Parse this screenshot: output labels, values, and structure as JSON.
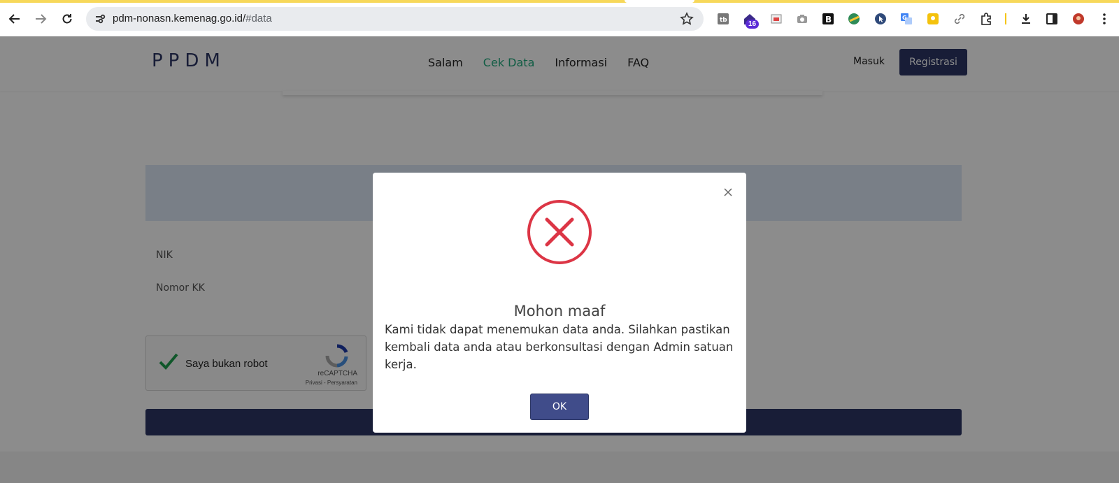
{
  "browser": {
    "url_host": "pdm-nonasn.kemenag.go.id/",
    "url_path": "#data",
    "extension_badge": "16",
    "icons": [
      "back-icon",
      "forward-icon",
      "reload-icon",
      "site-info-icon",
      "bookmark-star-icon",
      "extensions-icon",
      "downloads-icon",
      "side-panel-icon",
      "profile-avatar-icon",
      "menu-icon"
    ]
  },
  "site": {
    "logo": "PPDM",
    "nav": [
      "Salam",
      "Cek Data",
      "Informasi",
      "FAQ"
    ],
    "active_nav": "Cek Data",
    "login_label": "Masuk",
    "register_label": "Registrasi",
    "accent_color": "#2c3664",
    "active_color": "#1fa97d"
  },
  "form": {
    "nik_label": "NIK",
    "kk_label": "Nomor KK",
    "captcha": {
      "label": "Saya bukan robot",
      "brand": "reCAPTCHA",
      "links": "Privasi - Persyaratan"
    }
  },
  "modal": {
    "title": "Mohon maaf",
    "message": "Kami tidak dapat menemukan data anda. Silahkan pastikan kembali data anda atau berkonsultasi dengan Admin satuan kerja.",
    "ok_label": "OK",
    "error_color": "#dc3545"
  }
}
